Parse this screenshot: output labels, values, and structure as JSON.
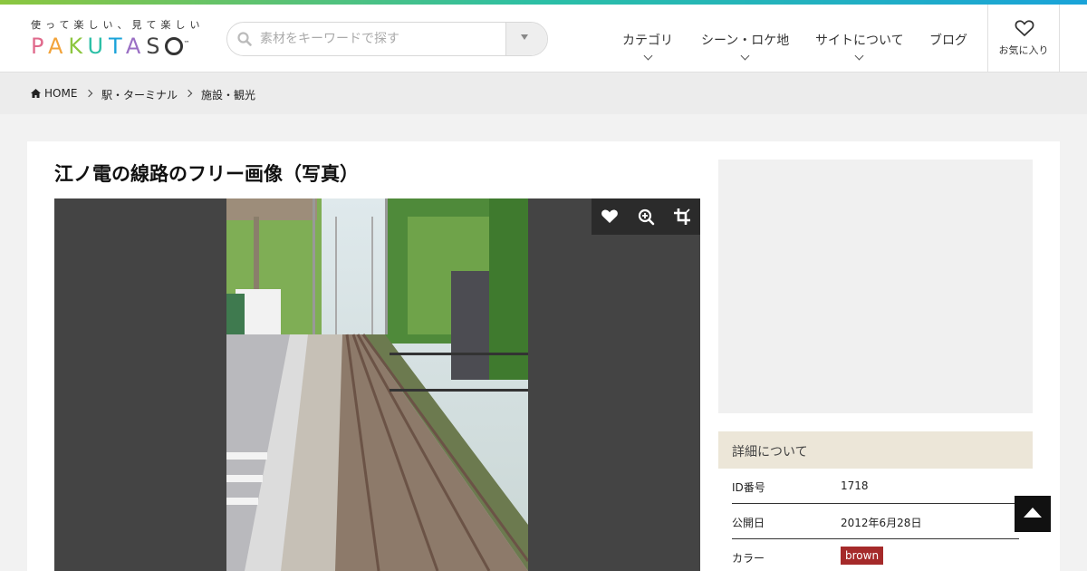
{
  "brand": {
    "tagline": "使って楽しい、見て楽しい",
    "name_letters": [
      "P",
      "A",
      "K",
      "U",
      "T",
      "A",
      "S"
    ],
    "tm": "™"
  },
  "search": {
    "placeholder": "素材をキーワードで探す"
  },
  "nav": {
    "items": [
      {
        "label": "カテゴリ",
        "has_dropdown": true
      },
      {
        "label": "シーン・ロケ地",
        "has_dropdown": true
      },
      {
        "label": "サイトについて",
        "has_dropdown": true
      },
      {
        "label": "ブログ",
        "has_dropdown": false
      }
    ],
    "favorites_label": "お気に入り"
  },
  "breadcrumb": {
    "home": "HOME",
    "items": [
      "駅・ターミナル",
      "施設・観光"
    ]
  },
  "page": {
    "title": "江ノ電の線路のフリー画像（写真）"
  },
  "viewer": {
    "tools": [
      "heart-icon",
      "zoom-in-icon",
      "crop-icon"
    ]
  },
  "details": {
    "heading": "詳細について",
    "rows": [
      {
        "key": "ID番号",
        "value": "1718"
      },
      {
        "key": "公開日",
        "value": "2012年6月28日"
      },
      {
        "key": "カラー",
        "value": "brown"
      }
    ]
  },
  "colors": {
    "accent_gradient": [
      "#8cc63f",
      "#2bbfa6",
      "#1aa3d9"
    ],
    "detail_header": "#ece6d8",
    "color_badge": "#a52a2a"
  }
}
